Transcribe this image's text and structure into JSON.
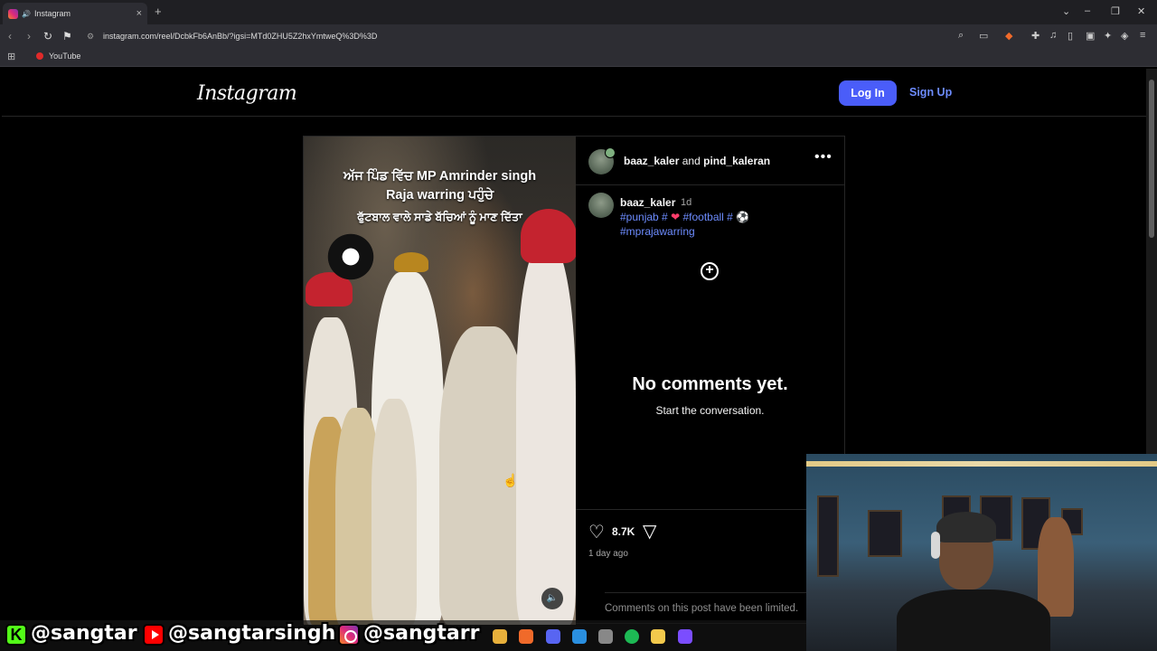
{
  "browser": {
    "tab_title": "Instagram",
    "url": "instagram.com/reel/DcbkFb6AnBb/?igsi=MTd0ZHU5Z2hxYmtweQ%3D%3D",
    "bookmark_youtube": "YouTube"
  },
  "header": {
    "logo": "Instagram",
    "login_label": "Log In",
    "signup_label": "Sign Up"
  },
  "post": {
    "overlay_line1": "ਅੱਜ ਪਿੰਡ ਵਿੱਚ MP Amrinder singh",
    "overlay_line2": "Raja warring ਪਹੁੰਚੇ",
    "overlay_line3": "ਫੁੱਟਬਾਲ ਵਾਲੇ ਸਾਡੇ ਬੱਚਿਆਂ ਨੂੰ ਮਾਣ ਦਿੱਤਾ",
    "author1": "baaz_kaler",
    "and_text": "and",
    "author2": "pind_kaleran",
    "caption_user": "baaz_kaler",
    "caption_time": "1d",
    "tags_line1": "#punjab # ",
    "tags_heart": "❤",
    "tags_line1b": " #football # ⚽",
    "tags_line2": "#mprajawarring",
    "no_comments": "No comments yet.",
    "start_conversation": "Start the conversation.",
    "likes": "8.7K",
    "posted_ago": "1 day ago",
    "comments_limited": "Comments on this post have been limited."
  },
  "socials": {
    "kick_handle": "@sangtar",
    "youtube_handle": "@sangtarsingh",
    "instagram_handle": "@sangtarr"
  },
  "colors": {
    "login_button": "#4a5df9",
    "link_blue": "#6d8cff",
    "background": "#000000"
  }
}
